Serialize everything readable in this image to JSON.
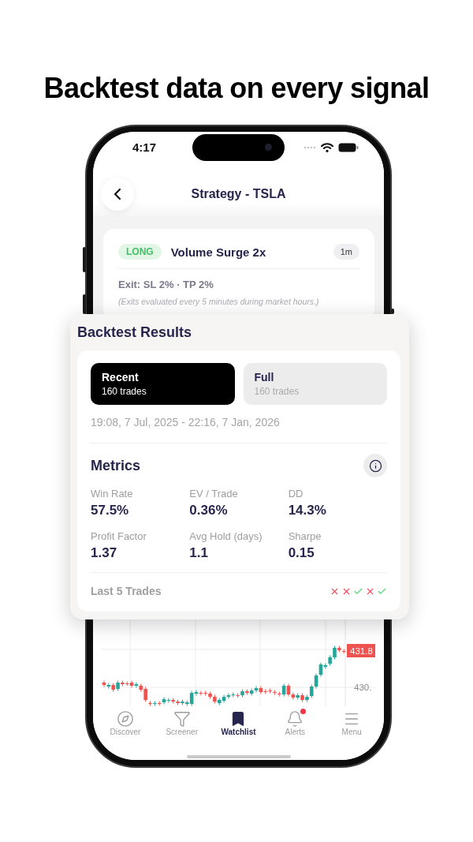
{
  "headline": "Backtest data on every signal",
  "status_bar": {
    "time": "4:17"
  },
  "header": {
    "title": "Strategy - TSLA"
  },
  "signal": {
    "direction": "LONG",
    "name": "Volume Surge 2x",
    "timeframe": "1m",
    "exit_rule": "Exit: SL 2% · TP 2%",
    "note": "(Exits evaluated every 5 minutes during market hours.)"
  },
  "backtest": {
    "title": "Backtest Results",
    "tabs": [
      {
        "label": "Recent",
        "trades": "160 trades",
        "selected": true
      },
      {
        "label": "Full",
        "trades": "160 trades",
        "selected": false
      }
    ],
    "date_range": "19:08, 7 Jul, 2025 - 22:16, 7 Jan, 2026",
    "metrics_title": "Metrics",
    "metrics": [
      {
        "label": "Win Rate",
        "value": "57.5%"
      },
      {
        "label": "EV / Trade",
        "value": "0.36%"
      },
      {
        "label": "DD",
        "value": "14.3%"
      },
      {
        "label": "Profit Factor",
        "value": "1.37"
      },
      {
        "label": "Avg Hold (days)",
        "value": "1.1"
      },
      {
        "label": "Sharpe",
        "value": "0.15"
      }
    ],
    "last_trades": {
      "label": "Last 5 Trades",
      "results": [
        {
          "kind": "loss"
        },
        {
          "kind": "loss"
        },
        {
          "kind": "win"
        },
        {
          "kind": "loss"
        },
        {
          "kind": "win"
        }
      ]
    }
  },
  "chart": {
    "price_tag": "431.8",
    "axis_label": "430."
  },
  "tab_bar": [
    {
      "label": "Discover",
      "selected": false,
      "badge": false
    },
    {
      "label": "Screener",
      "selected": false,
      "badge": false
    },
    {
      "label": "Watchlist",
      "selected": true,
      "badge": false
    },
    {
      "label": "Alerts",
      "selected": false,
      "badge": true
    },
    {
      "label": "Menu",
      "selected": false,
      "badge": false
    }
  ]
}
